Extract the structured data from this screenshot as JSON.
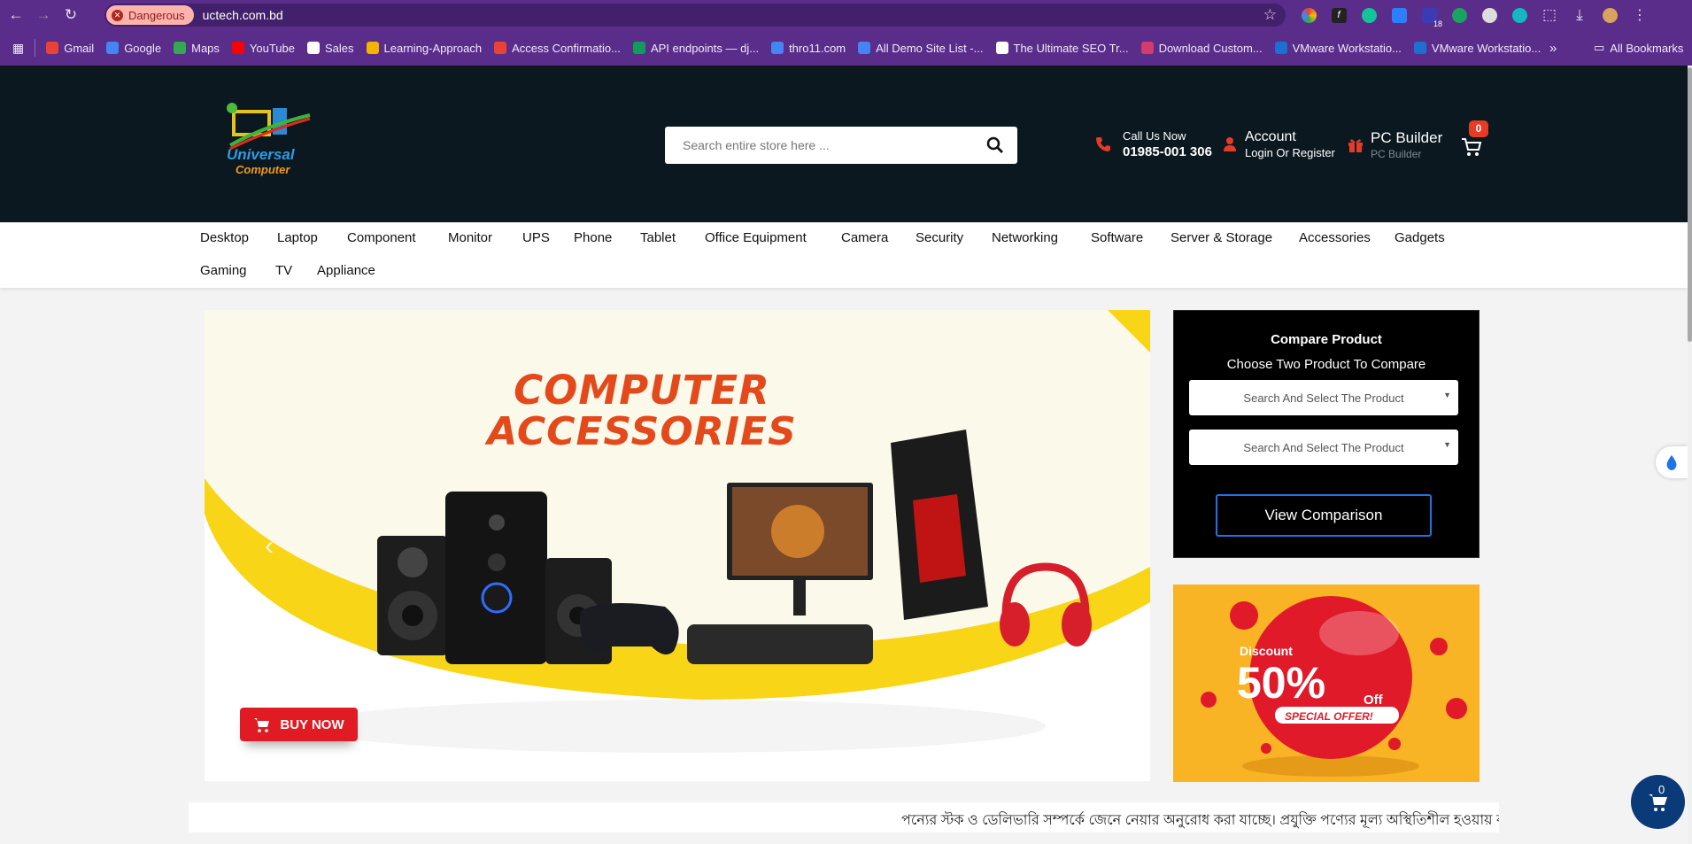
{
  "browser": {
    "security_label": "Dangerous",
    "url": "uctech.com.bd",
    "extension_badge": "18",
    "bookmarks": [
      {
        "label": "Gmail",
        "color": "#ea4335"
      },
      {
        "label": "Google",
        "color": "#4285f4"
      },
      {
        "label": "Maps",
        "color": "#34a853"
      },
      {
        "label": "YouTube",
        "color": "#ff0000"
      },
      {
        "label": "Sales",
        "color": "#ffffff"
      },
      {
        "label": "Learning-Approach",
        "color": "#f4b400"
      },
      {
        "label": "Access Confirmatio...",
        "color": "#ea4335"
      },
      {
        "label": "API endpoints — dj...",
        "color": "#0f9d58"
      },
      {
        "label": "thro11.com",
        "color": "#4285f4"
      },
      {
        "label": "All Demo Site List -...",
        "color": "#4285f4"
      },
      {
        "label": "The Ultimate SEO Tr...",
        "color": "#ffffff"
      },
      {
        "label": "Download Custom...",
        "color": "#d23b6a"
      },
      {
        "label": "VMware Workstatio...",
        "color": "#1d6fd1"
      },
      {
        "label": "VMware Workstatio...",
        "color": "#1d6fd1"
      }
    ],
    "more": "»",
    "all_bookmarks": "All Bookmarks"
  },
  "header": {
    "search_placeholder": "Search entire store here ...",
    "call_label": "Call Us Now",
    "call_number": "01985-001 306",
    "account_title": "Account",
    "account_sub": "Login Or Register",
    "pcbuilder_title": "PC Builder",
    "pcbuilder_sub": "PC Builder",
    "cart_count": "0"
  },
  "nav": {
    "categories": [
      "Desktop",
      "Laptop",
      "Component",
      "Monitor",
      "UPS",
      "Phone",
      "Tablet",
      "Office Equipment",
      "Camera",
      "Security",
      "Networking",
      "Software",
      "Server & Storage",
      "Accessories",
      "Gadgets",
      "Gaming",
      "TV",
      "Appliance"
    ]
  },
  "hero": {
    "title_line1": "COMPUTER",
    "title_line2": "ACCESSORIES",
    "cta": "BUY NOW"
  },
  "compare": {
    "title": "Compare Product",
    "subtitle": "Choose Two Product To Compare",
    "select1": "Search And Select The Product",
    "select2": "Search And Select The Product",
    "button": "View Comparison"
  },
  "promo": {
    "line1": "Discount",
    "line2": "50%",
    "line3": "Off",
    "line4": "SPECIAL OFFER!"
  },
  "ticker": "পন্যের স্টক ও ডেলিভারি সম্পর্কে জেনে নেয়ার অনুরোধ করা যাচ্ছে। প্রযুক্তি পণ্যের মূল্য অস্থিতিশীল হওয়ায় কারণে।",
  "float_cart_count": "0"
}
